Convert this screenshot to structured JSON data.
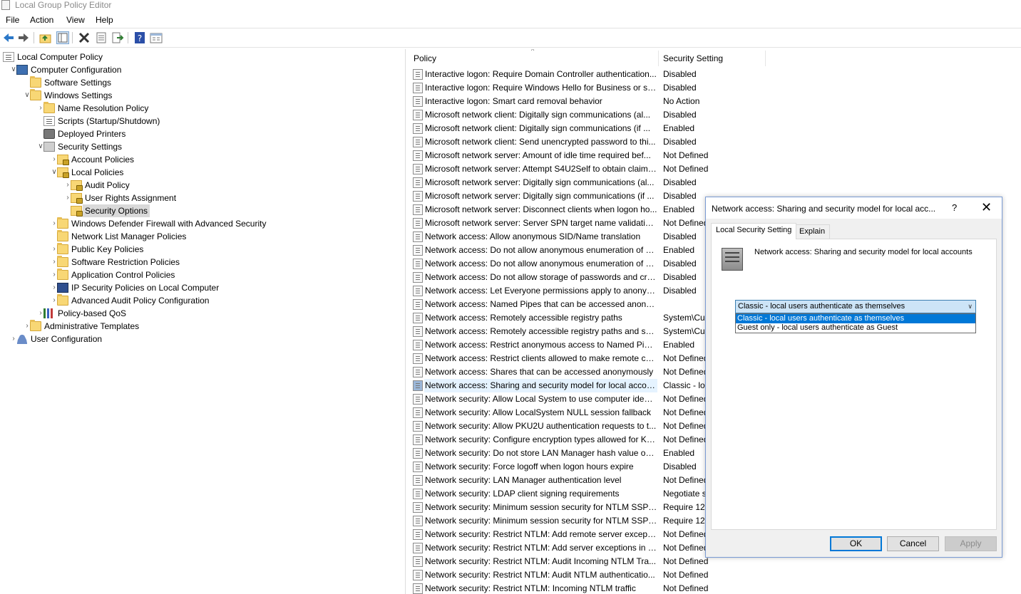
{
  "window": {
    "title": "Local Group Policy Editor"
  },
  "menu": [
    "File",
    "Action",
    "View",
    "Help"
  ],
  "toolbar": [
    "back-icon",
    "forward-icon",
    "up-folder-icon",
    "show-hide-tree-icon",
    "delete-icon",
    "properties-icon",
    "export-list-icon",
    "help-icon",
    "view-icon"
  ],
  "tree": [
    {
      "label": "Local Computer Policy",
      "depth": 0,
      "expander": "",
      "icon": "scroll"
    },
    {
      "label": "Computer Configuration",
      "depth": 1,
      "expander": "open",
      "icon": "pc"
    },
    {
      "label": "Software Settings",
      "depth": 2,
      "expander": "",
      "icon": "folder"
    },
    {
      "label": "Windows Settings",
      "depth": 2,
      "expander": "open",
      "icon": "folder"
    },
    {
      "label": "Name Resolution Policy",
      "depth": 3,
      "expander": "closed",
      "icon": "folder"
    },
    {
      "label": "Scripts (Startup/Shutdown)",
      "depth": 3,
      "expander": "",
      "icon": "scroll"
    },
    {
      "label": "Deployed Printers",
      "depth": 3,
      "expander": "",
      "icon": "printer"
    },
    {
      "label": "Security Settings",
      "depth": 3,
      "expander": "open",
      "icon": "shield"
    },
    {
      "label": "Account Policies",
      "depth": 4,
      "expander": "closed",
      "icon": "lockfolder"
    },
    {
      "label": "Local Policies",
      "depth": 4,
      "expander": "open",
      "icon": "lockfolder"
    },
    {
      "label": "Audit Policy",
      "depth": 5,
      "expander": "closed",
      "icon": "lockfolder"
    },
    {
      "label": "User Rights Assignment",
      "depth": 5,
      "expander": "closed",
      "icon": "lockfolder"
    },
    {
      "label": "Security Options",
      "depth": 5,
      "expander": "",
      "icon": "lockfolder",
      "selected": true
    },
    {
      "label": "Windows Defender Firewall with Advanced Security",
      "depth": 4,
      "expander": "closed",
      "icon": "folder"
    },
    {
      "label": "Network List Manager Policies",
      "depth": 4,
      "expander": "",
      "icon": "folder"
    },
    {
      "label": "Public Key Policies",
      "depth": 4,
      "expander": "closed",
      "icon": "folder"
    },
    {
      "label": "Software Restriction Policies",
      "depth": 4,
      "expander": "closed",
      "icon": "folder"
    },
    {
      "label": "Application Control Policies",
      "depth": 4,
      "expander": "closed",
      "icon": "folder"
    },
    {
      "label": "IP Security Policies on Local Computer",
      "depth": 4,
      "expander": "closed",
      "icon": "ipsec"
    },
    {
      "label": "Advanced Audit Policy Configuration",
      "depth": 4,
      "expander": "closed",
      "icon": "folder"
    },
    {
      "label": "Policy-based QoS",
      "depth": 3,
      "expander": "closed",
      "icon": "chart"
    },
    {
      "label": "Administrative Templates",
      "depth": 2,
      "expander": "closed",
      "icon": "folder"
    },
    {
      "label": "User Configuration",
      "depth": 1,
      "expander": "closed",
      "icon": "user"
    }
  ],
  "list": {
    "col_policy": "Policy",
    "col_setting": "Security Setting",
    "rows": [
      {
        "policy": "Interactive logon: Require Domain Controller authentication...",
        "setting": "Disabled"
      },
      {
        "policy": "Interactive logon: Require Windows Hello for Business or sm...",
        "setting": "Disabled"
      },
      {
        "policy": "Interactive logon: Smart card removal behavior",
        "setting": "No Action"
      },
      {
        "policy": "Microsoft network client: Digitally sign communications (al...",
        "setting": "Disabled"
      },
      {
        "policy": "Microsoft network client: Digitally sign communications (if ...",
        "setting": "Enabled"
      },
      {
        "policy": "Microsoft network client: Send unencrypted password to thi...",
        "setting": "Disabled"
      },
      {
        "policy": "Microsoft network server: Amount of idle time required bef...",
        "setting": "Not Defined"
      },
      {
        "policy": "Microsoft network server: Attempt S4U2Self to obtain claim ...",
        "setting": "Not Defined"
      },
      {
        "policy": "Microsoft network server: Digitally sign communications (al...",
        "setting": "Disabled"
      },
      {
        "policy": "Microsoft network server: Digitally sign communications (if ...",
        "setting": "Disabled"
      },
      {
        "policy": "Microsoft network server: Disconnect clients when logon ho...",
        "setting": "Enabled"
      },
      {
        "policy": "Microsoft network server: Server SPN target name validation...",
        "setting": "Not Defined"
      },
      {
        "policy": "Network access: Allow anonymous SID/Name translation",
        "setting": "Disabled"
      },
      {
        "policy": "Network access: Do not allow anonymous enumeration of S...",
        "setting": "Enabled"
      },
      {
        "policy": "Network access: Do not allow anonymous enumeration of S...",
        "setting": "Disabled"
      },
      {
        "policy": "Network access: Do not allow storage of passwords and cre...",
        "setting": "Disabled"
      },
      {
        "policy": "Network access: Let Everyone permissions apply to anonym...",
        "setting": "Disabled"
      },
      {
        "policy": "Network access: Named Pipes that can be accessed anonym...",
        "setting": ""
      },
      {
        "policy": "Network access: Remotely accessible registry paths",
        "setting": "System\\Cu"
      },
      {
        "policy": "Network access: Remotely accessible registry paths and sub...",
        "setting": "System\\Cu"
      },
      {
        "policy": "Network access: Restrict anonymous access to Named Pipes...",
        "setting": "Enabled"
      },
      {
        "policy": "Network access: Restrict clients allowed to make remote call...",
        "setting": "Not Defined"
      },
      {
        "policy": "Network access: Shares that can be accessed anonymously",
        "setting": "Not Defined"
      },
      {
        "policy": "Network access: Sharing and security model for local accou...",
        "setting": "Classic - loc",
        "selected": true
      },
      {
        "policy": "Network security: Allow Local System to use computer ident...",
        "setting": "Not Defined"
      },
      {
        "policy": "Network security: Allow LocalSystem NULL session fallback",
        "setting": "Not Defined"
      },
      {
        "policy": "Network security: Allow PKU2U authentication requests to t...",
        "setting": "Not Defined"
      },
      {
        "policy": "Network security: Configure encryption types allowed for Ke...",
        "setting": "Not Defined"
      },
      {
        "policy": "Network security: Do not store LAN Manager hash value on ...",
        "setting": "Enabled"
      },
      {
        "policy": "Network security: Force logoff when logon hours expire",
        "setting": "Disabled"
      },
      {
        "policy": "Network security: LAN Manager authentication level",
        "setting": "Not Defined"
      },
      {
        "policy": "Network security: LDAP client signing requirements",
        "setting": "Negotiate s"
      },
      {
        "policy": "Network security: Minimum session security for NTLM SSP ...",
        "setting": "Require 128"
      },
      {
        "policy": "Network security: Minimum session security for NTLM SSP ...",
        "setting": "Require 128"
      },
      {
        "policy": "Network security: Restrict NTLM: Add remote server excepti...",
        "setting": "Not Defined"
      },
      {
        "policy": "Network security: Restrict NTLM: Add server exceptions in t...",
        "setting": "Not Defined"
      },
      {
        "policy": "Network security: Restrict NTLM: Audit Incoming NTLM Tra...",
        "setting": "Not Defined"
      },
      {
        "policy": "Network security: Restrict NTLM: Audit NTLM authenticatio...",
        "setting": "Not Defined"
      },
      {
        "policy": "Network security: Restrict NTLM: Incoming NTLM traffic",
        "setting": "Not Defined"
      }
    ]
  },
  "dialog": {
    "title": "Network access: Sharing and security model for local acc...",
    "help": "?",
    "close": "✕",
    "tabs": [
      "Local Security Setting",
      "Explain"
    ],
    "policy_name": "Network access: Sharing and security model for local accounts",
    "selected_value": "Classic - local users authenticate as themselves",
    "options": [
      "Classic - local users authenticate as themselves",
      "Guest only - local users authenticate as Guest"
    ],
    "buttons": {
      "ok": "OK",
      "cancel": "Cancel",
      "apply": "Apply"
    }
  }
}
